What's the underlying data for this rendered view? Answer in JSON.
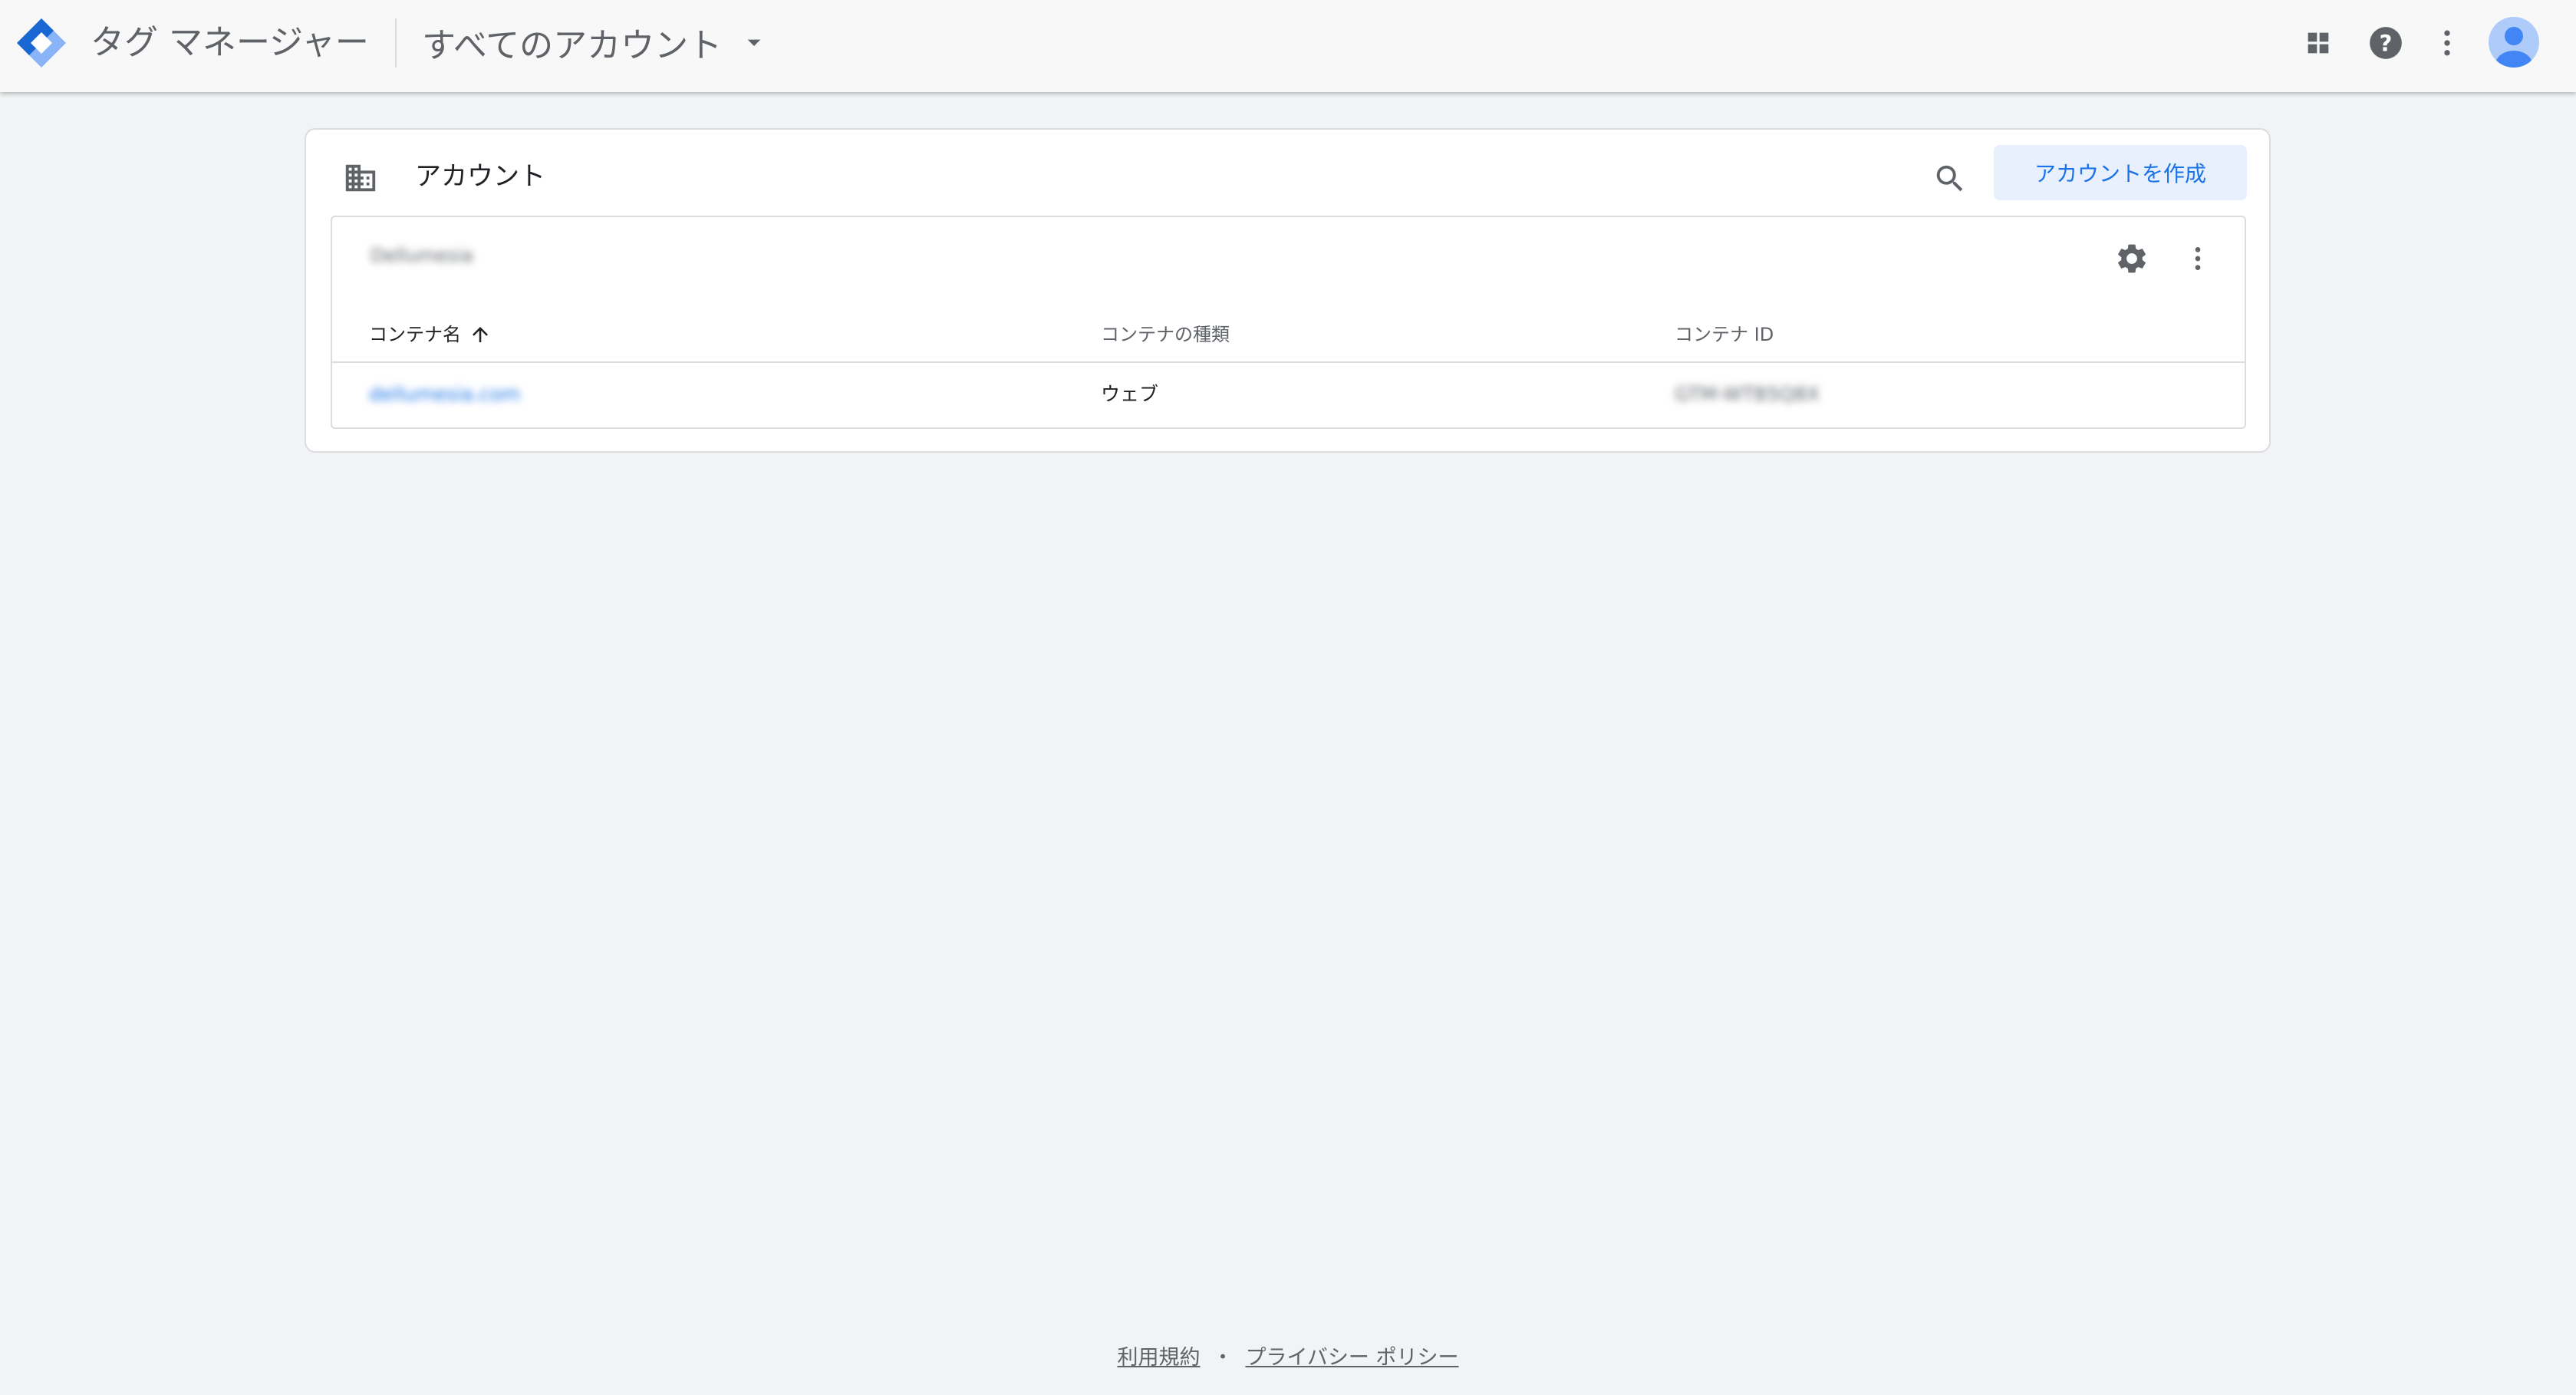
{
  "app": {
    "product_name": "タグ マネージャー",
    "account_switcher_label": "すべてのアカウント"
  },
  "colors": {
    "accent": "#1a73e8",
    "accent_light": "#e8f0fe",
    "logo_blue_dark": "#1967d2",
    "logo_blue_light": "#8ab4f8",
    "avatar_bg": "#aecbfa",
    "avatar_fg": "#4285f4",
    "icon_gray": "#5f6368"
  },
  "icons": {
    "logo": "tag-manager-logo",
    "apps": "apps-grid-icon",
    "help": "help-circle-icon",
    "more": "more-vert-icon",
    "avatar": "account-avatar",
    "account_card": "domain-building-icon",
    "search": "search-icon",
    "settings": "gear-icon",
    "sort": "arrow-up-icon"
  },
  "accounts_card": {
    "title": "アカウント",
    "create_button": "アカウントを作成",
    "account": {
      "name": "Dellumesia",
      "table": {
        "columns": {
          "name": "コンテナ名",
          "type": "コンテナの種類",
          "id": "コンテナ ID"
        },
        "rows": [
          {
            "name": "dellumesia.com",
            "type": "ウェブ",
            "id": "GTM-WTB5Q8X"
          }
        ]
      }
    }
  },
  "footer": {
    "terms": "利用規約",
    "separator": "・",
    "privacy": "プライバシー ポリシー"
  }
}
